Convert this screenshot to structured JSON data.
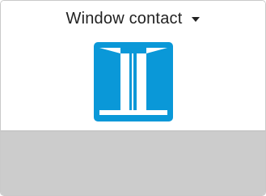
{
  "tile": {
    "title": "Window contact",
    "icon": "window-open-icon",
    "accent_color": "#0a98d8",
    "footer_color": "#cccccc"
  }
}
